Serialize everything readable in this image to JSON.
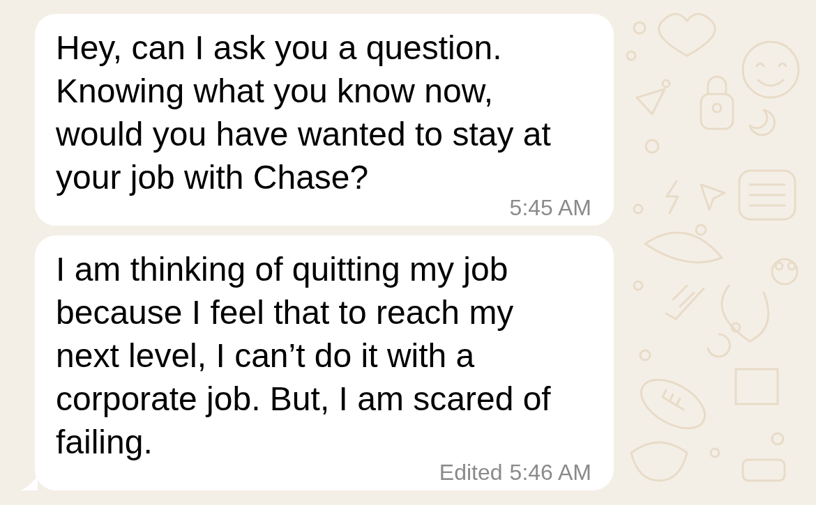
{
  "messages": [
    {
      "text": "Hey, can I ask you a question.\nKnowing what you know now,\nwould you have wanted to stay at\nyour job with Chase?",
      "time": "5:45 AM",
      "tail": false
    },
    {
      "text": "I am thinking of quitting my job\nbecause I feel that to reach my\nnext level, I can’t do it with a\ncorporate job. But, I am scared of\nfailing.",
      "edited": "Edited",
      "time": "5:46 AM",
      "tail": true
    }
  ]
}
